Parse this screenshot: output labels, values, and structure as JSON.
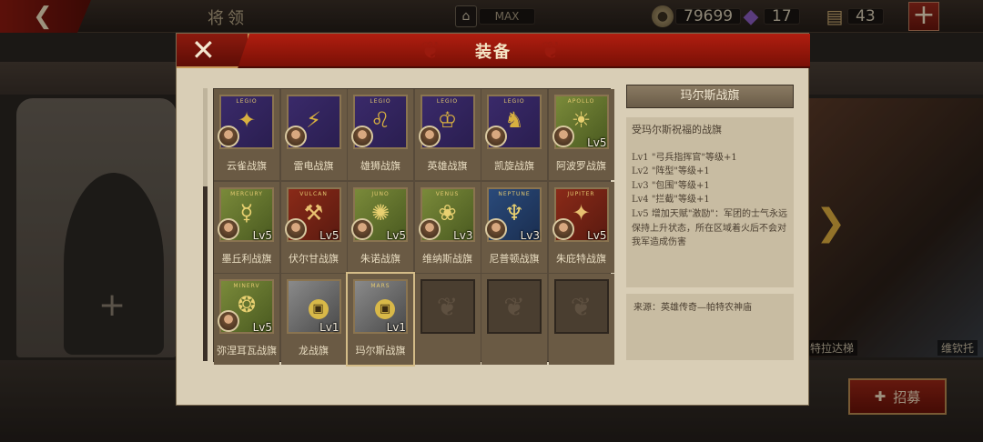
{
  "top_bar": {
    "back_label": "❮",
    "title": "将领",
    "max_label": "MAX",
    "coins": "79699",
    "gems": "17",
    "scrolls": "43",
    "add_label": "+"
  },
  "background": {
    "empty_slot_plus": "+",
    "hero_name_1": "特拉达梯",
    "hero_name_2": "维钦托",
    "recruit_label": "招募"
  },
  "modal": {
    "title": "装备",
    "close_label": "✕"
  },
  "banners": [
    {
      "name": "云雀战旗",
      "cap": "LEGIO",
      "insignia": "✦",
      "color": "purple",
      "level": "",
      "locked": false
    },
    {
      "name": "雷电战旗",
      "cap": "",
      "insignia": "⚡",
      "color": "purple",
      "level": "",
      "locked": false
    },
    {
      "name": "雄狮战旗",
      "cap": "LEGIO",
      "insignia": "♌",
      "color": "purple",
      "level": "",
      "locked": false
    },
    {
      "name": "英雄战旗",
      "cap": "LEGIO",
      "insignia": "♔",
      "color": "purple",
      "level": "",
      "locked": false
    },
    {
      "name": "凯旋战旗",
      "cap": "LEGIO",
      "insignia": "♞",
      "color": "purple",
      "level": "",
      "locked": false
    },
    {
      "name": "阿波罗战旗",
      "cap": "APOLLO",
      "insignia": "☀",
      "color": "green",
      "level": "Lv5",
      "locked": false
    },
    {
      "name": "墨丘利战旗",
      "cap": "MERCURY",
      "insignia": "☿",
      "color": "green",
      "level": "Lv5",
      "locked": false
    },
    {
      "name": "伏尔甘战旗",
      "cap": "VULCAN",
      "insignia": "⚒",
      "color": "red",
      "level": "Lv5",
      "locked": false
    },
    {
      "name": "朱诺战旗",
      "cap": "JUNO",
      "insignia": "✺",
      "color": "green",
      "level": "Lv5",
      "locked": false
    },
    {
      "name": "维纳斯战旗",
      "cap": "VENUS",
      "insignia": "❀",
      "color": "green",
      "level": "Lv3",
      "locked": false
    },
    {
      "name": "尼普顿战旗",
      "cap": "NEPTUNE",
      "insignia": "♆",
      "color": "blue",
      "level": "Lv3",
      "locked": false
    },
    {
      "name": "朱庇特战旗",
      "cap": "JUPITER",
      "insignia": "✦",
      "color": "red",
      "level": "Lv5",
      "locked": false
    },
    {
      "name": "弥涅耳瓦战旗",
      "cap": "MINERV",
      "insignia": "❂",
      "color": "green",
      "level": "Lv5",
      "locked": false
    },
    {
      "name": "龙战旗",
      "cap": "",
      "insignia": "",
      "color": "grey",
      "level": "Lv1",
      "locked": true
    },
    {
      "name": "玛尔斯战旗",
      "cap": "MARS",
      "insignia": "",
      "color": "grey",
      "level": "Lv1",
      "locked": true
    }
  ],
  "empty_slots": 3,
  "selected_index": 14,
  "detail": {
    "title": "玛尔斯战旗",
    "description": "受玛尔斯祝福的战旗",
    "lines": [
      "Lv1 \"弓兵指挥官\"等级+1",
      "Lv2 \"阵型\"等级+1",
      "Lv3 \"包围\"等级+1",
      "Lv4 \"拦截\"等级+1",
      "Lv5 增加天赋\"激励\"：军团的士气永远保持上升状态，所在区域着火后不会对我军造成伤害"
    ],
    "source": "来源：英雄传奇—帕特农神庙"
  },
  "colors": {
    "accent_red": "#b01e10",
    "panel_beige": "#d9ceb6",
    "gold": "#d8b848"
  }
}
